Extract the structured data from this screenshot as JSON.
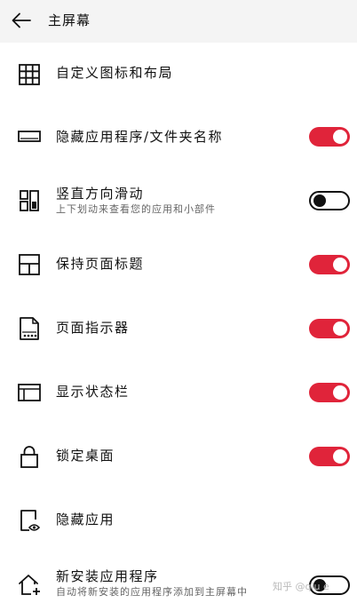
{
  "header": {
    "title": "主屏幕"
  },
  "items": [
    {
      "label": "自定义图标和布局",
      "icon": "grid-icon"
    },
    {
      "label": "隐藏应用程序/文件夹名称",
      "icon": "label-bar-icon",
      "toggle": true
    },
    {
      "label": "竖直方向滑动",
      "sublabel": "上下划动来查看您的应用和小部件",
      "icon": "vertical-scroll-icon",
      "toggle": false
    },
    {
      "label": "保持页面标题",
      "icon": "page-title-layout-icon",
      "toggle": true
    },
    {
      "label": "页面指示器",
      "icon": "page-indicator-icon",
      "toggle": true
    },
    {
      "label": "显示状态栏",
      "icon": "status-bar-icon",
      "toggle": true
    },
    {
      "label": "锁定桌面",
      "icon": "lock-icon",
      "toggle": true
    },
    {
      "label": "隐藏应用",
      "icon": "hidden-app-icon"
    },
    {
      "label": "新安装应用程序",
      "sublabel": "自动将新安装的应用程序添加到主屏幕中",
      "icon": "home-add-icon",
      "toggle": false
    }
  ],
  "watermark": "知乎 @qiu e",
  "colors": {
    "accent": "#e0243a",
    "header_bg": "#f4f4f4"
  }
}
